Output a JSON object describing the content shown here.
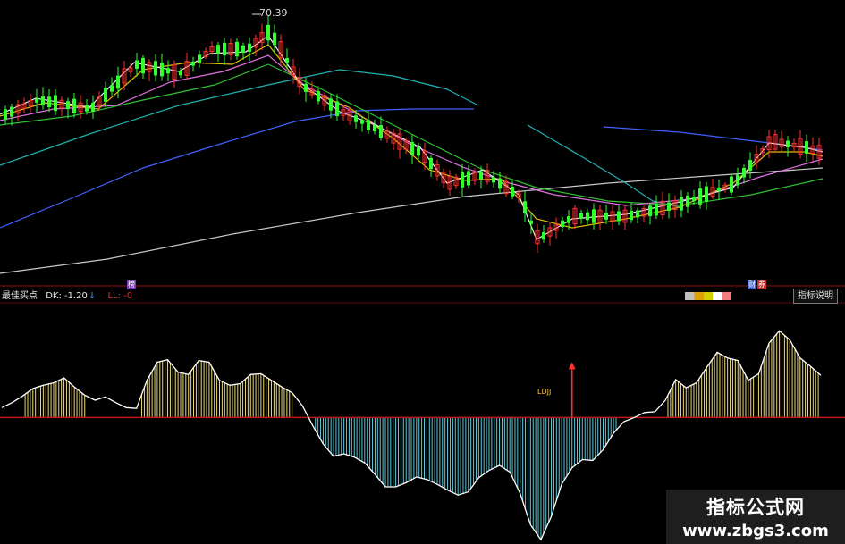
{
  "price_panel": {
    "peak_label": "70.39",
    "ma_colors": [
      "#f0f0f0",
      "#e0c000",
      "#e070e0",
      "#30c030",
      "#20b0b0",
      "#4060ff",
      "#c8c8c8"
    ],
    "up_color": "#ff3030",
    "down_color": "#30ff30",
    "badge_1": "榜",
    "badge_2": "财",
    "badge_3": "券"
  },
  "indicator_panel": {
    "name": "最佳买点",
    "dk_label": "DK: -1.20",
    "dk_arrow": "↓",
    "ll_label": "LL: -0",
    "help_button": "指标说明",
    "signal_label": "LDJJ",
    "line_color": "#ffffff",
    "zero_line_color": "#c01818",
    "positive_bar_color": "#e8d878",
    "negative_bar_color": "#5ac8d8",
    "arrow_color": "#ff3030"
  },
  "watermark": {
    "title": "指标公式网",
    "url": "www.zbgs3.com"
  },
  "chart_data": {
    "type": "line",
    "title": "",
    "xlabel": "",
    "ylabel": "",
    "series": [
      {
        "values": [
          1.2,
          1.8,
          2.6,
          3.5,
          3.9,
          4.2,
          4.8,
          3.7,
          2.7,
          2.1,
          2.5,
          1.8,
          1.2,
          1.1,
          4.5,
          6.7,
          7.0,
          5.5,
          5.2,
          6.9,
          6.7,
          4.5,
          3.9,
          4.1,
          5.2,
          5.3,
          4.5,
          3.7,
          3.0,
          1.4,
          -1.0,
          -3.2,
          -4.7,
          -4.4,
          -4.8,
          -5.5,
          -6.9,
          -8.4,
          -8.4,
          -7.9,
          -7.2,
          -7.5,
          -8.1,
          -8.8,
          -9.4,
          -9.0,
          -7.3,
          -6.4,
          -5.8,
          -6.6,
          -9.2,
          -13.0,
          -14.8,
          -12.0,
          -8.1,
          -6.1,
          -5.1,
          -5.2,
          -3.9,
          -1.9,
          -0.5,
          0.0,
          0.6,
          0.7,
          2.1,
          4.6,
          3.6,
          4.2,
          6.1,
          7.9,
          7.2,
          6.9,
          4.5,
          5.3,
          9.0,
          10.5,
          9.4,
          7.2,
          6.2,
          5.1
        ]
      }
    ],
    "signal_index": 55,
    "ylim": [
      -15,
      14
    ]
  }
}
